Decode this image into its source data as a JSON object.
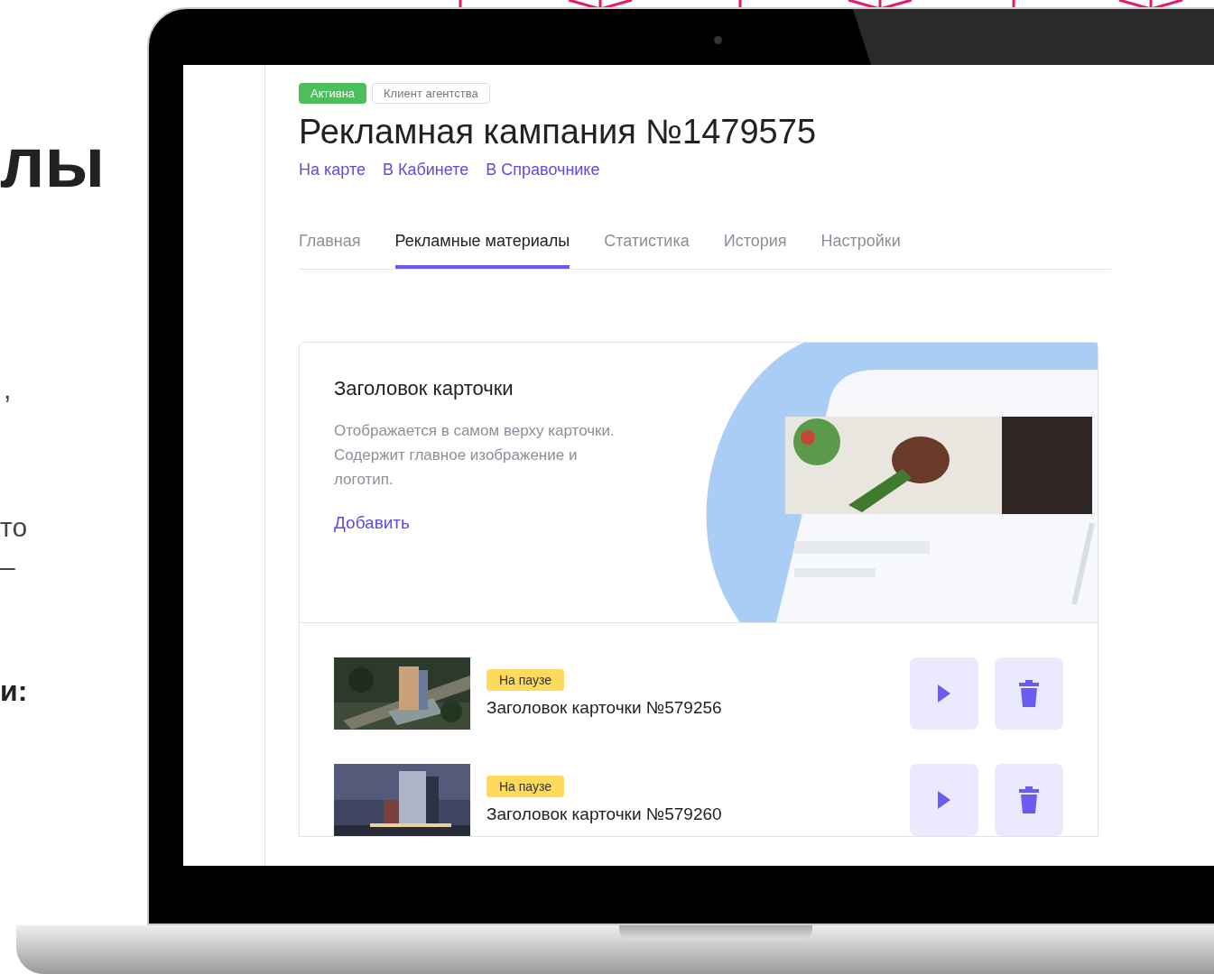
{
  "slide": {
    "fragments": [
      {
        "text": "лы",
        "kind": "heading"
      },
      {
        "text": ",",
        "kind": "body"
      },
      {
        "text": "то",
        "kind": "body"
      },
      {
        "text": "–",
        "kind": "body"
      },
      {
        "text": "и:",
        "kind": "bold"
      }
    ]
  },
  "campaign": {
    "badges": [
      {
        "text": "Активна",
        "kind": "status"
      },
      {
        "text": "Клиент агентства",
        "kind": "outline"
      }
    ],
    "title": "Рекламная кампания №1479575",
    "links": [
      "На карте",
      "В Кабинете",
      "В Справочнике"
    ]
  },
  "tabs": [
    {
      "label": "Главная",
      "selected": false
    },
    {
      "label": "Рекламные материалы",
      "selected": true
    },
    {
      "label": "Статистика",
      "selected": false
    },
    {
      "label": "История",
      "selected": false
    },
    {
      "label": "Настройки",
      "selected": false
    }
  ],
  "header_card": {
    "title": "Заголовок карточки",
    "description": "Отображается в самом верху карточки. Содержит главное изображение и логотип.",
    "action": "Добавить"
  },
  "cards": [
    {
      "status": "На паузе",
      "title": "Заголовок карточки №579256"
    },
    {
      "status": "На паузе",
      "title": "Заголовок карточки №579260"
    }
  ]
}
